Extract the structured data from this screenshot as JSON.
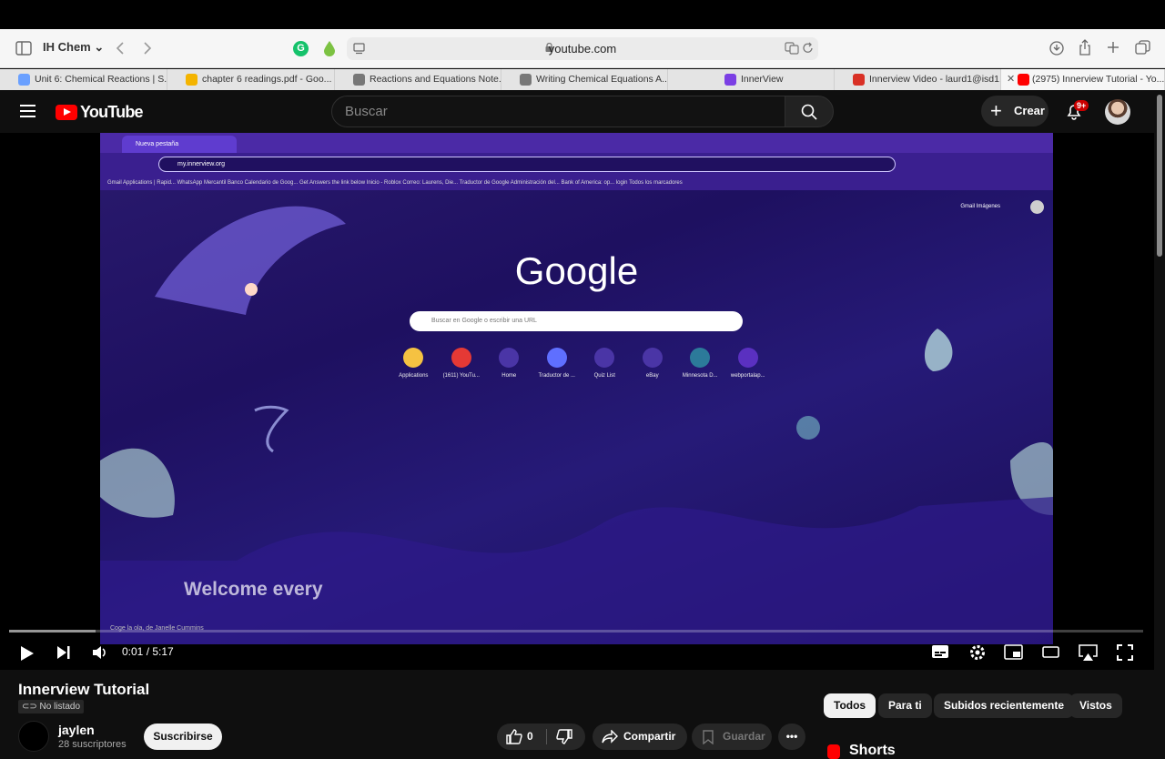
{
  "browser": {
    "profile": "IH Chem",
    "address": "youtube.com",
    "tabs": [
      {
        "label": "Unit 6: Chemical Reactions | S...",
        "color": "#6aa0ff"
      },
      {
        "label": "chapter 6 readings.pdf - Goo...",
        "color": "#f4b400"
      },
      {
        "label": "Reactions and Equations Note...",
        "color": "#777777"
      },
      {
        "label": "Writing Chemical Equations A...",
        "color": "#777777"
      },
      {
        "label": "InnerView",
        "color": "#7b3fe4"
      },
      {
        "label": "Innerview Video - laurd1@isd1...",
        "color": "#d93025"
      },
      {
        "label": "(2975) Innerview Tutorial - Yo...",
        "color": "#ff0000"
      }
    ]
  },
  "youtube": {
    "logo_text": "YouTube",
    "search_placeholder": "Buscar",
    "create_label": "Crear",
    "notifications_badge": "9+"
  },
  "video": {
    "inner_tab": "Nueva pestaña",
    "inner_url": "my.innerview.org",
    "inner_bookmarks": "Gmail   Applications | Rapid...   WhatsApp   Mercantil Banco   Calendario de Goog...   Get Answers   the link below   Inicio - Roblox   Correo: Laurens, Die...   Traductor de Google   Administración del...   Bank of America: op...   login        Todos los marcadores",
    "google_text": "Google",
    "inner_search_placeholder": "Buscar en Google o escribir una URL",
    "gmail_links": "Gmail  Imágenes",
    "shortcuts": [
      "Applications",
      "(1611) YouTu...",
      "Home",
      "Traductor de ...",
      "Quiz List",
      "eBay",
      "Minnesota D...",
      "webportalap..."
    ],
    "overlay_text": "Welcome every",
    "credit": "Coge la ola, de Janelle Cummins",
    "time": "0:01 / 5:17",
    "progress": 0.008
  },
  "meta": {
    "title": "Innerview Tutorial",
    "unlisted": "No listado",
    "channel": "jaylen",
    "subscribers": "28 suscriptores",
    "subscribe": "Suscribirse",
    "likes": "0",
    "share": "Compartir",
    "save": "Guardar",
    "chips": [
      "Todos",
      "Para ti",
      "Subidos recientemente",
      "Vistos"
    ],
    "shorts": "Shorts"
  }
}
